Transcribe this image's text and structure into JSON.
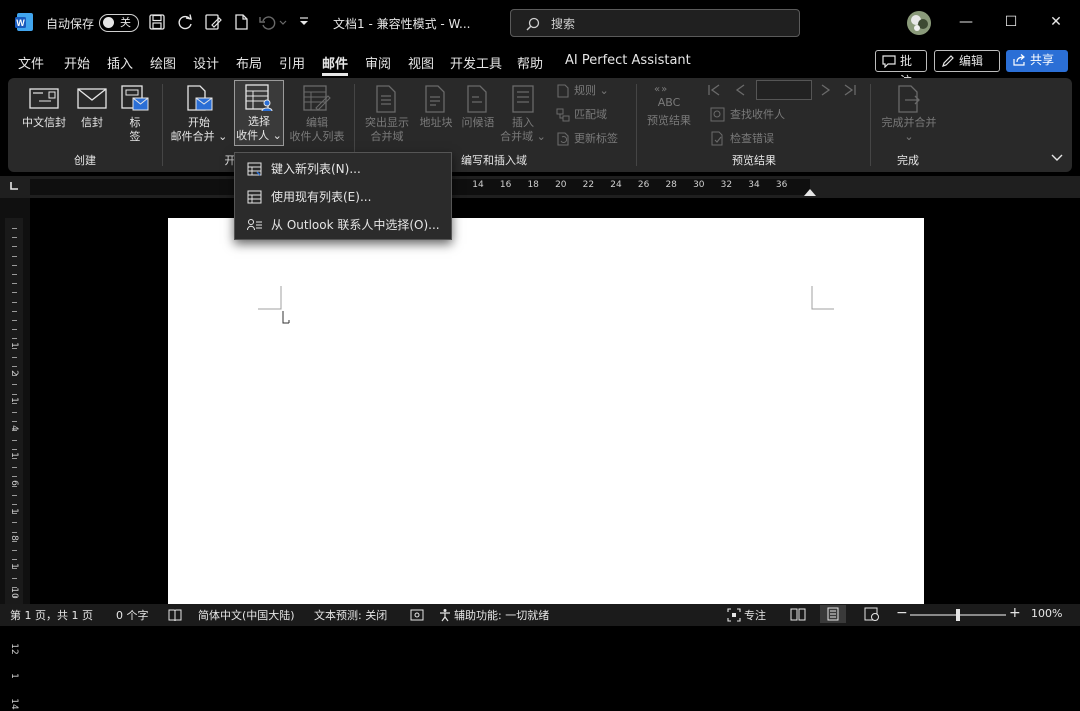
{
  "titlebar": {
    "autosave_label": "自动保存",
    "autosave_state": "关",
    "doc_title": "文档1 - 兼容性模式 - W...",
    "search_placeholder": "搜索",
    "minimize": "—",
    "maximize": "☐",
    "close": "✕"
  },
  "menu": {
    "tabs": [
      "文件",
      "开始",
      "插入",
      "绘图",
      "设计",
      "布局",
      "引用",
      "邮件",
      "审阅",
      "视图",
      "开发工具",
      "帮助",
      "AI Perfect Assistant"
    ],
    "active_tab": "邮件",
    "comments_label": "批注",
    "edit_label": "编辑",
    "share_label": "共享"
  },
  "ribbon": {
    "groups": {
      "create": "创建",
      "start": "开",
      "write_insert": "编写和插入域",
      "preview": "预览结果",
      "finish": "完成"
    },
    "buttons": {
      "chinese_envelope": "中文信封",
      "envelope": "信封",
      "labels_1": "标",
      "labels_2": "签",
      "start_merge_1": "开始",
      "start_merge_2": "邮件合并 ⌄",
      "select_recipients_1": "选择",
      "select_recipients_2": "收件人 ⌄",
      "edit_list_1": "编辑",
      "edit_list_2": "收件人列表",
      "highlight_1": "突出显示",
      "highlight_2": "合并域",
      "address_block": "地址块",
      "greeting": "问候语",
      "insert_field_1": "插入",
      "insert_field_2": "合并域 ⌄",
      "rules": "规则 ⌄",
      "match_fields": "匹配域",
      "update_labels": "更新标签",
      "abc": "ABC",
      "preview_results": "预览结果",
      "find_recipient": "查找收件人",
      "check_errors": "检查错误",
      "finish_merge": "完成并合并"
    }
  },
  "dropdown": {
    "items": [
      "键入新列表(N)...",
      "使用现有列表(E)...",
      "从 Outlook 联系人中选择(O)..."
    ]
  },
  "ruler": {
    "h_ticks": [
      "14",
      "16",
      "18",
      "20",
      "22",
      "24",
      "26",
      "28",
      "30",
      "32",
      "34",
      "36"
    ],
    "v_ticks": [
      "1",
      "2",
      "1",
      "4",
      "1",
      "6",
      "1",
      "8",
      "1",
      "10",
      "1",
      "12",
      "1",
      "14"
    ]
  },
  "statusbar": {
    "page": "第 1 页，共 1 页",
    "words": "0 个字",
    "language": "简体中文(中国大陆)",
    "prediction": "文本预测: 关闭",
    "accessibility": "辅助功能: 一切就绪",
    "focus": "专注",
    "zoom": "100%",
    "zoom_level": 1.0
  },
  "colors": {
    "accent_blue": "#2b6fd6",
    "ribbon_bg": "#292929",
    "page_bg": "#ffffff"
  }
}
